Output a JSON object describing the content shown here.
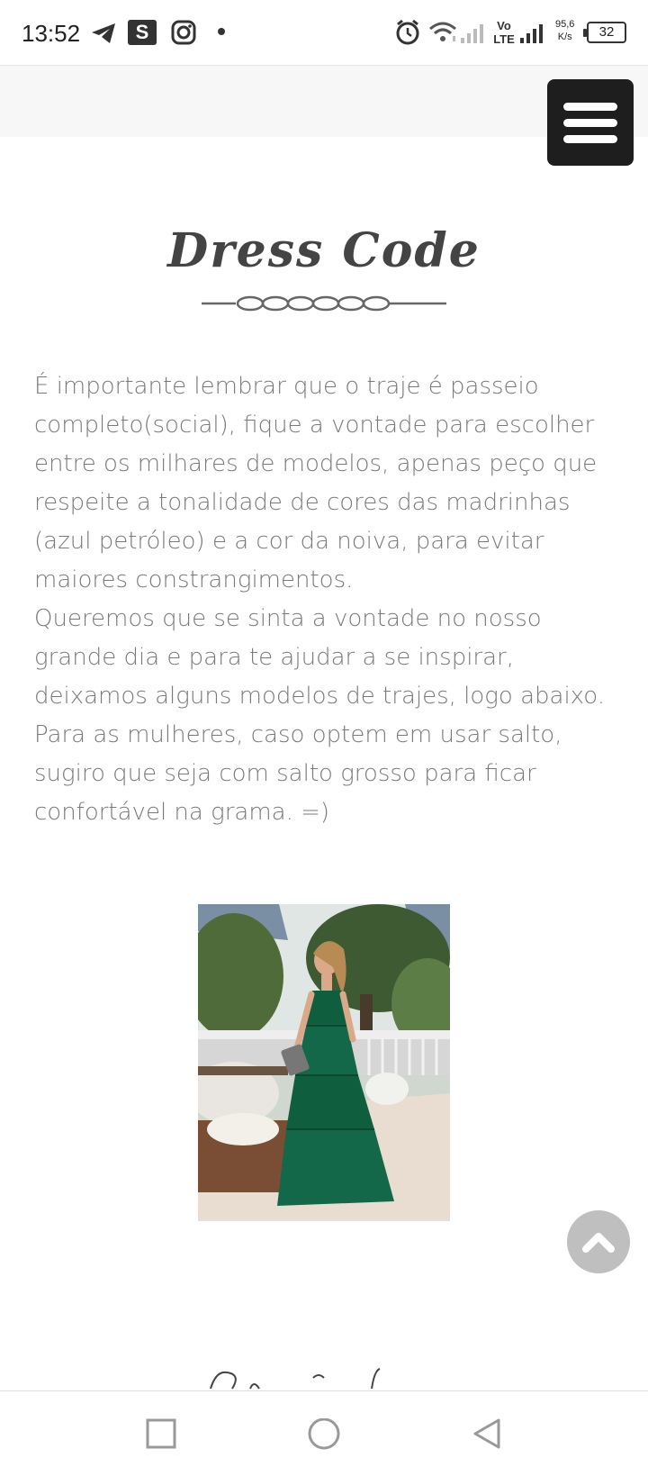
{
  "status_bar": {
    "time": "13:52",
    "app_badge": "S",
    "net_speed_value": "95,6",
    "net_speed_unit": "K/s",
    "battery": "32",
    "icons": [
      "telegram-icon",
      "s-app-icon",
      "instagram-icon",
      "notification-dot-icon",
      "alarm-icon",
      "wifi-icon",
      "signal-icon",
      "volte-icon",
      "signal-icon",
      "battery-icon"
    ]
  },
  "header": {
    "menu_icon": "hamburger-menu-icon"
  },
  "section": {
    "title": "Dress Code",
    "divider_icon": "ornamental-divider-icon",
    "body": "É importante lembrar que o traje é passeio completo(social), fique a vontade para escolher entre os milhares de modelos, apenas peço que respeite a tonalidade de cores das madrinhas (azul petróleo) e a cor da noiva, para evitar maiores constrangimentos.\nQueremos que se sinta a vontade no nosso grande dia e para te ajudar a se inspirar, deixamos alguns  modelos de trajes, logo abaixo. Para as mulheres, caso optem em usar salto, sugiro que seja com salto grosso para ficar confortável na grama. =)",
    "photo_icon": "dress-photo"
  },
  "scroll_top": {
    "icon": "chevron-up-icon"
  },
  "nav_bar": {
    "buttons": [
      "recents-square-icon",
      "home-circle-icon",
      "back-triangle-icon"
    ]
  },
  "colors": {
    "menu_bg": "#1e1e1e",
    "text": "#7a7a7a",
    "title": "#444444",
    "dress": "#0f5e3e",
    "scroll_btn": "#bfbfbf"
  }
}
